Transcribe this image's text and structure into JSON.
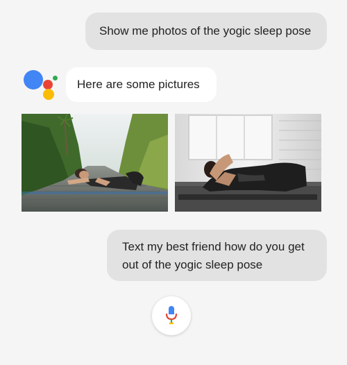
{
  "conversation": {
    "user_query_1": "Show me photos of the yogic sleep pose",
    "assistant_reply": "Here are some pictures",
    "user_query_2_line1": "Text my best friend how do you get",
    "user_query_2_line2": "out of the yogic sleep pose"
  },
  "images": [
    {
      "icon": "yoga-photo-outdoor-path"
    },
    {
      "icon": "yoga-photo-indoor-studio"
    }
  ],
  "colors": {
    "page_background": "#f5f5f5",
    "user_bubble": "#e2e2e2",
    "assistant_bubble": "#ffffff",
    "google_blue": "#4285f4",
    "google_red": "#ea4335",
    "google_yellow": "#fbbc05",
    "google_green": "#34a853"
  },
  "mic": {
    "icon": "microphone-icon"
  }
}
